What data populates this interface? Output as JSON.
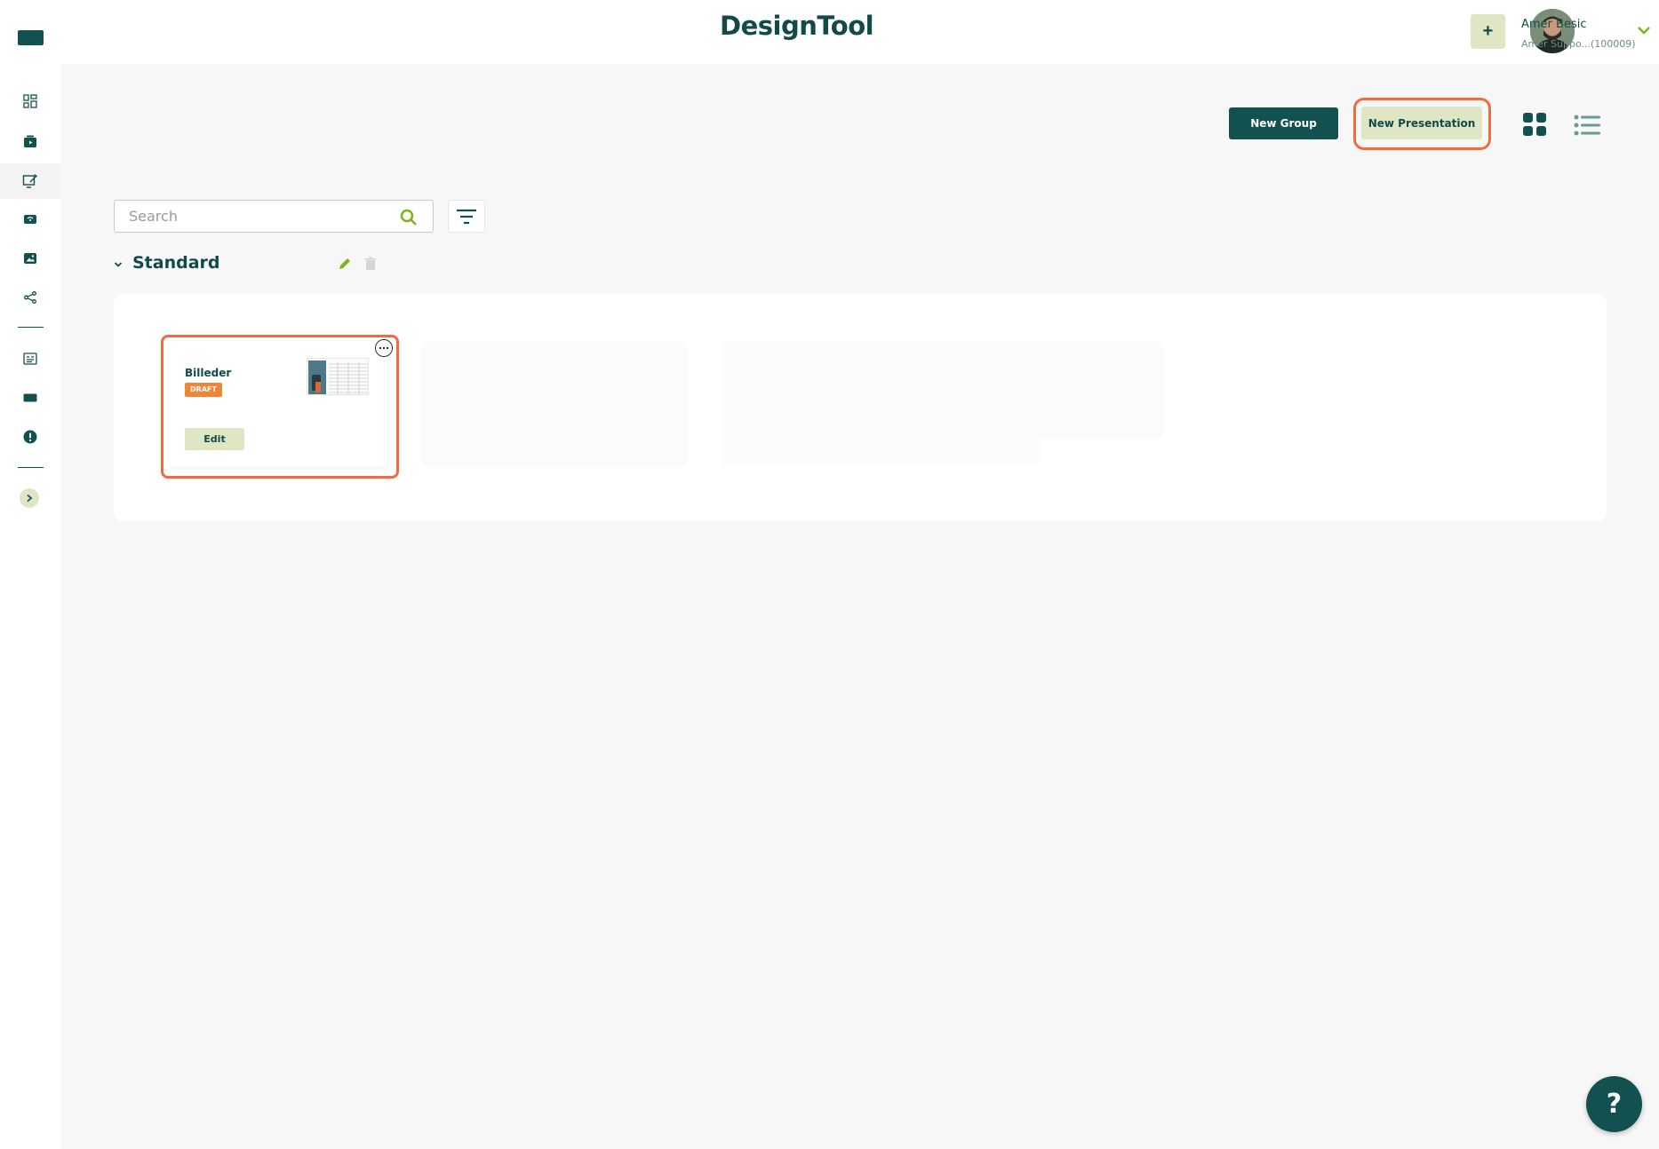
{
  "header": {
    "brand": "DesignTool",
    "plus_label": "+",
    "user": {
      "name": "Amer Besic",
      "subtitle": "Amer Suppo...(100009)"
    }
  },
  "toolbar": {
    "new_group_label": "New Group",
    "new_presentation_label": "New Presentation"
  },
  "search": {
    "placeholder": "Search",
    "value": ""
  },
  "group": {
    "title": "Standard",
    "cards": [
      {
        "title": "Billeder",
        "status": "DRAFT",
        "edit_label": "Edit"
      }
    ]
  },
  "help": {
    "label": "?"
  },
  "sidebar": {
    "icons": [
      "dashboard-icon",
      "media-icon",
      "presentation-edit-icon",
      "player-icon",
      "image-icon",
      "share-icon",
      "schedule-icon",
      "screen-icon",
      "alert-icon",
      "expand-chevron-icon"
    ]
  },
  "colors": {
    "primary": "#135050",
    "accent": "#dfe6c4",
    "highlight": "#f26a3e",
    "draft": "#ef8636",
    "lime": "#7cb518"
  }
}
